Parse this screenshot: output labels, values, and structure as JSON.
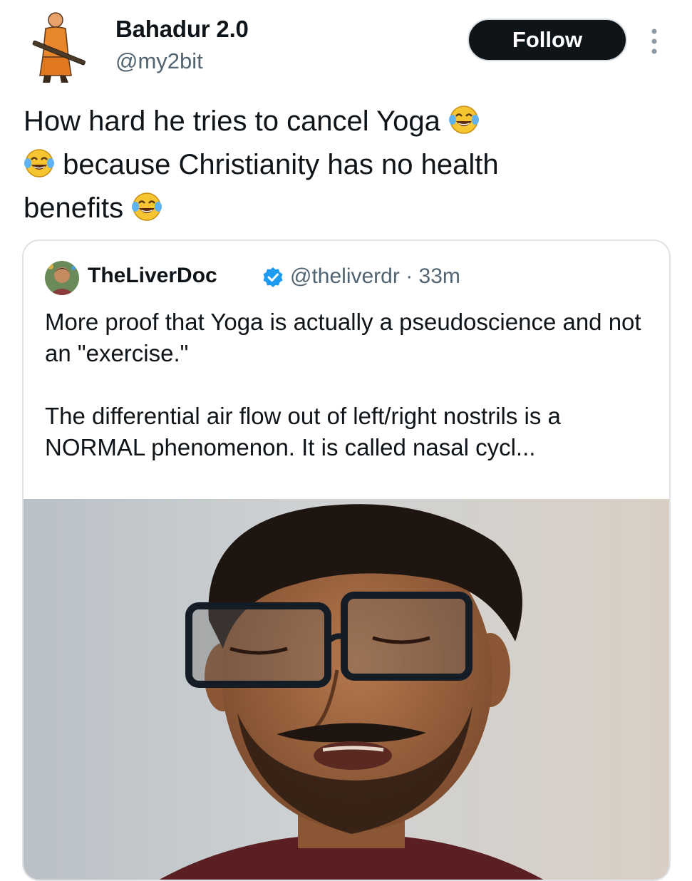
{
  "tweet": {
    "author_name": "Bahadur 2.0",
    "author_handle": "@my2bit",
    "follow_label": "Follow",
    "text_line1": "How hard he tries to cancel Yoga",
    "text_line2": "because Christianity has no health",
    "text_line3": "benefits",
    "emoji": "face-with-tears-of-joy"
  },
  "quote": {
    "author_name": "TheLiverDoc",
    "verified": true,
    "handle": "@theliverdr",
    "separator": "·",
    "time": "33m",
    "paragraph1": "More proof that Yoga is actually a pseudoscience and not an \"exercise.\"",
    "paragraph2": "The differential air flow out of left/right nostrils is a NORMAL phenomenon. It is called nasal cycl..."
  },
  "colors": {
    "text": "#0f1419",
    "secondary": "#536471",
    "follow_bg": "#0f1419",
    "verified": "#1d9bf0",
    "border": "#dfe3e6"
  }
}
